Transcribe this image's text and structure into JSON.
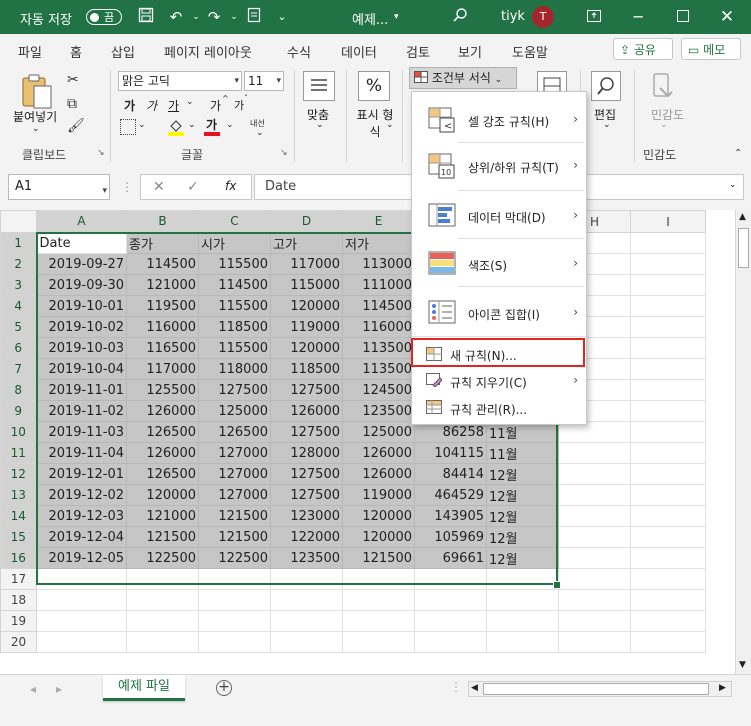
{
  "titlebar": {
    "autosave_label": "자동 저장",
    "autosave_state": "끔",
    "doc_title": "예제...",
    "user_name": "tiyk",
    "avatar_initial": "T",
    "accent": "#217346"
  },
  "menu": {
    "tabs": [
      "파일",
      "홈",
      "삽입",
      "페이지 레이아웃",
      "수식",
      "데이터",
      "검토",
      "보기",
      "도움말"
    ],
    "active": "홈",
    "share_label": "공유",
    "comment_label": "메모"
  },
  "ribbon": {
    "paste_label": "붙여넣기",
    "clipboard_group": "클립보드",
    "font_name": "맑은 고딕",
    "font_size": "11",
    "font_group": "글꼴",
    "bold": "가",
    "italic": "가",
    "underline": "가",
    "grow": "가",
    "shrink": "가",
    "font_color": "가",
    "phonetic": "내선",
    "align_label": "맞춤",
    "number_label": "표시 형식",
    "number_symbol": "%",
    "cf_label": "조건부 서식",
    "edit_label": "편집",
    "sensitivity_label": "민감도",
    "sensitivity_group": "민감도"
  },
  "formula_bar": {
    "name_box": "A1",
    "fx": "fx",
    "content": "Date"
  },
  "sheet": {
    "columns": [
      "A",
      "B",
      "C",
      "D",
      "E",
      "F",
      "G",
      "H",
      "I"
    ],
    "header_row": [
      "Date",
      "종가",
      "시가",
      "고가",
      "저가"
    ],
    "rows": [
      [
        "2019-09-27",
        "114500",
        "115500",
        "117000",
        "113000",
        "",
        ""
      ],
      [
        "2019-09-30",
        "121000",
        "114500",
        "115000",
        "111000",
        "",
        ""
      ],
      [
        "2019-10-01",
        "119500",
        "115500",
        "120000",
        "114500",
        "",
        ""
      ],
      [
        "2019-10-02",
        "116000",
        "118500",
        "119000",
        "116000",
        "",
        ""
      ],
      [
        "2019-10-03",
        "116500",
        "115500",
        "120000",
        "113500",
        "",
        ""
      ],
      [
        "2019-10-04",
        "117000",
        "118000",
        "118500",
        "113500",
        "",
        ""
      ],
      [
        "2019-11-01",
        "125500",
        "127500",
        "127500",
        "124500",
        "",
        ""
      ],
      [
        "2019-11-02",
        "126000",
        "125000",
        "126000",
        "123500",
        "",
        ""
      ],
      [
        "2019-11-03",
        "126500",
        "126500",
        "127500",
        "125000",
        "86258",
        "11월"
      ],
      [
        "2019-11-04",
        "126000",
        "127000",
        "128000",
        "126000",
        "104115",
        "11월"
      ],
      [
        "2019-12-01",
        "126500",
        "127000",
        "127500",
        "126000",
        "84414",
        "12월"
      ],
      [
        "2019-12-02",
        "120000",
        "127000",
        "127500",
        "119000",
        "464529",
        "12월"
      ],
      [
        "2019-12-03",
        "121000",
        "121500",
        "123000",
        "120000",
        "143905",
        "12월"
      ],
      [
        "2019-12-04",
        "121500",
        "121500",
        "122000",
        "120000",
        "105969",
        "12월"
      ],
      [
        "2019-12-05",
        "122500",
        "122500",
        "123500",
        "121500",
        "69661",
        "12월"
      ]
    ],
    "row_numbers": [
      "1",
      "2",
      "3",
      "4",
      "5",
      "6",
      "7",
      "8",
      "9",
      "10",
      "11",
      "12",
      "13",
      "14",
      "15",
      "16",
      "17",
      "18",
      "19",
      "20"
    ],
    "tab_name": "예제 파일"
  },
  "dropdown": {
    "items": [
      {
        "label": "셀 강조 규칙(H)",
        "submenu": true
      },
      {
        "label": "상위/하위 규칙(T)",
        "submenu": true
      },
      {
        "label": "데이터 막대(D)",
        "submenu": true
      },
      {
        "label": "색조(S)",
        "submenu": true
      },
      {
        "label": "아이콘 집합(I)",
        "submenu": true
      },
      {
        "label": "새 규칙(N)...",
        "submenu": false
      },
      {
        "label": "규칙 지우기(C)",
        "submenu": true
      },
      {
        "label": "규칙 관리(R)...",
        "submenu": false
      }
    ],
    "highlight_color": "#e0261f"
  }
}
